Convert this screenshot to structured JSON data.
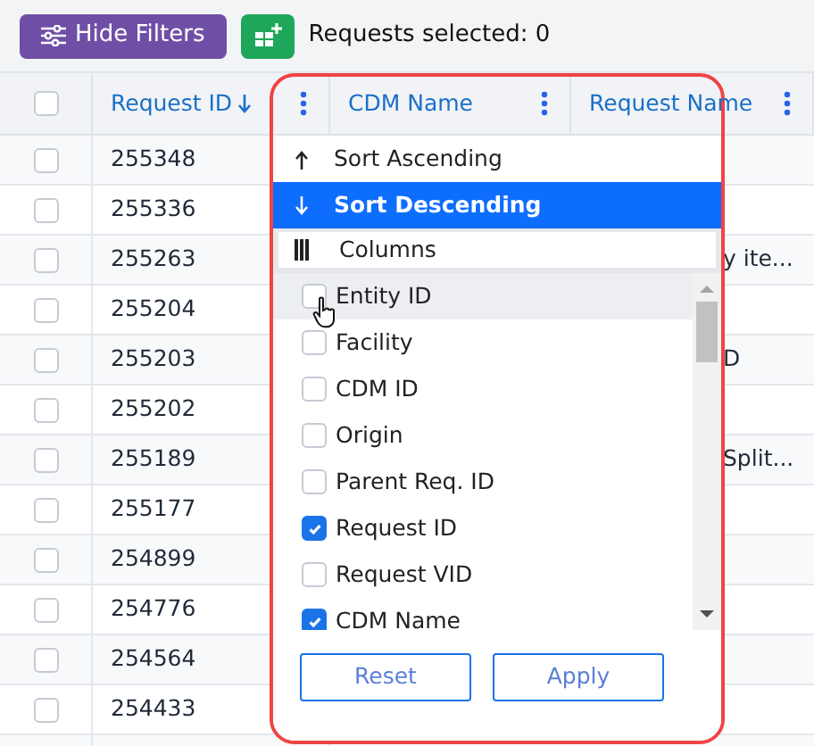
{
  "toolbar": {
    "hide_filters_button": "Hide Filters",
    "selection_label": "Requests selected: 0"
  },
  "table": {
    "all_checked": false,
    "columns": [
      {
        "label": "Request ID",
        "sorted": true
      },
      {
        "label": "CDM Name",
        "sorted": false
      },
      {
        "label": "Request Name",
        "sorted": false
      }
    ],
    "rows": [
      {
        "checked": false,
        "request_id": "255348"
      },
      {
        "checked": false,
        "request_id": "255336"
      },
      {
        "checked": false,
        "request_id": "255263",
        "request_name": "y ite..."
      },
      {
        "checked": false,
        "request_id": "255204"
      },
      {
        "checked": false,
        "request_id": "255203",
        "request_name": "D"
      },
      {
        "checked": false,
        "request_id": "255202"
      },
      {
        "checked": false,
        "request_id": "255189",
        "request_name": "Split..."
      },
      {
        "checked": false,
        "request_id": "255177"
      },
      {
        "checked": false,
        "request_id": "254899"
      },
      {
        "checked": false,
        "request_id": "254776"
      },
      {
        "checked": false,
        "request_id": "254564"
      },
      {
        "checked": false,
        "request_id": "254433"
      }
    ]
  },
  "column_menu": {
    "sort_items": [
      {
        "kind": "ascending",
        "label": "Sort Ascending",
        "selected": false
      },
      {
        "kind": "descending",
        "label": "Sort Descending",
        "selected": true
      }
    ],
    "columns_header": "Columns",
    "columns": [
      {
        "label": "Entity ID",
        "checked": false,
        "hovered": true
      },
      {
        "label": "Facility",
        "checked": false,
        "hovered": false
      },
      {
        "label": "CDM ID",
        "checked": false,
        "hovered": false
      },
      {
        "label": "Origin",
        "checked": false,
        "hovered": false
      },
      {
        "label": "Parent Req. ID",
        "checked": false,
        "hovered": false
      },
      {
        "label": "Request ID",
        "checked": true,
        "hovered": false
      },
      {
        "label": "Request VID",
        "checked": false,
        "hovered": false
      },
      {
        "label": "CDM Name",
        "checked": true,
        "hovered": false
      }
    ],
    "buttons": [
      "Reset",
      "Apply"
    ]
  }
}
